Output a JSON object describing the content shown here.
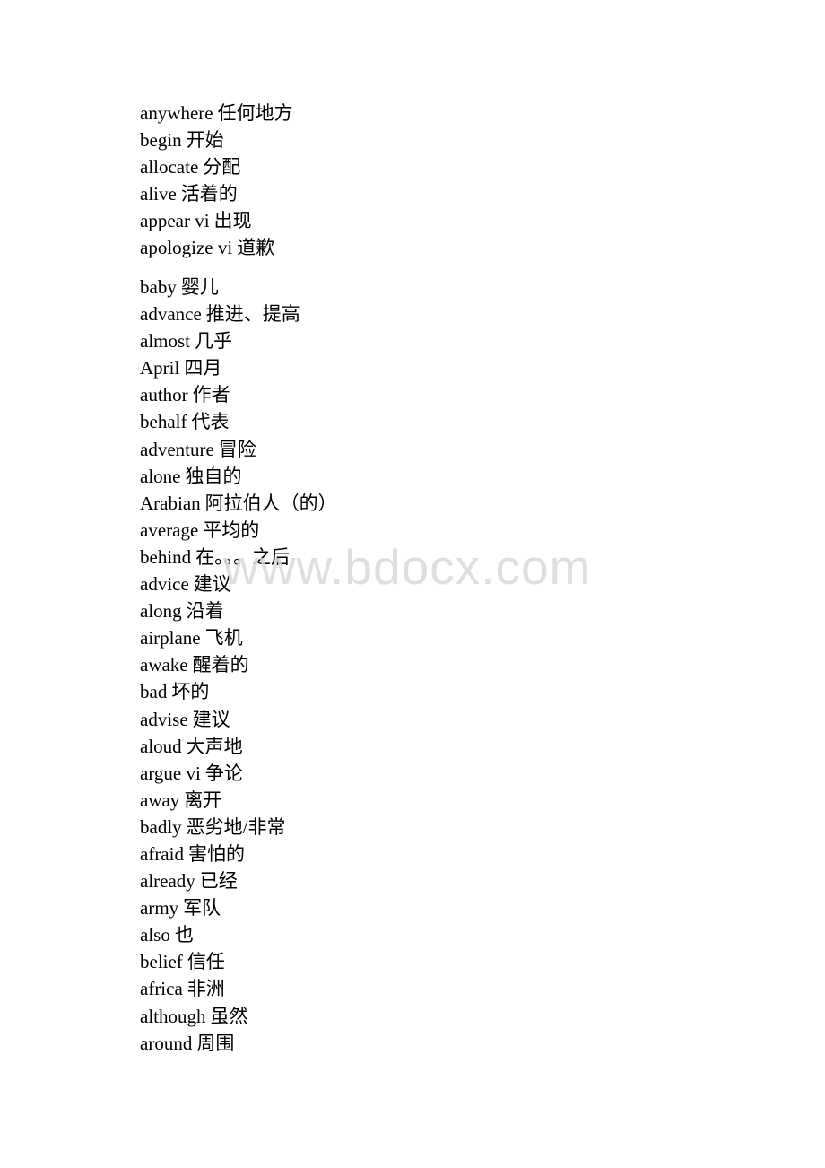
{
  "watermark": "www.bdocx.com",
  "groups": [
    {
      "entries": [
        {
          "word": "anywhere",
          "meaning": "任何地方"
        },
        {
          "word": "begin",
          "meaning": "开始"
        },
        {
          "word": "allocate",
          "meaning": "分配"
        },
        {
          "word": "alive",
          "meaning": "活着的"
        },
        {
          "word": "appear vi",
          "meaning": "出现"
        },
        {
          "word": "apologize vi",
          "meaning": "道歉"
        }
      ]
    },
    {
      "entries": [
        {
          "word": "baby",
          "meaning": "婴儿"
        },
        {
          "word": "advance",
          "meaning": "推进、提高"
        },
        {
          "word": "almost",
          "meaning": "几乎"
        },
        {
          "word": "April",
          "meaning": "四月"
        },
        {
          "word": "author",
          "meaning": "作者"
        },
        {
          "word": "behalf",
          "meaning": "代表"
        },
        {
          "word": "adventure",
          "meaning": "冒险"
        },
        {
          "word": "alone",
          "meaning": "独自的"
        },
        {
          "word": "Arabian",
          "meaning": "阿拉伯人（的）"
        },
        {
          "word": "average",
          "meaning": "平均的"
        },
        {
          "word": "behind",
          "meaning": "在。。。之后"
        },
        {
          "word": "advice",
          "meaning": "建议"
        },
        {
          "word": "along",
          "meaning": "沿着"
        },
        {
          "word": "airplane",
          "meaning": "飞机"
        },
        {
          "word": "awake",
          "meaning": "醒着的"
        },
        {
          "word": "bad",
          "meaning": "坏的"
        },
        {
          "word": "advise",
          "meaning": "建议"
        },
        {
          "word": "aloud",
          "meaning": "大声地"
        },
        {
          "word": "argue vi",
          "meaning": "争论"
        },
        {
          "word": "away",
          "meaning": "离开"
        },
        {
          "word": "badly",
          "meaning": "恶劣地/非常"
        },
        {
          "word": "afraid",
          "meaning": "害怕的"
        },
        {
          "word": "already",
          "meaning": "已经"
        },
        {
          "word": "army",
          "meaning": "军队"
        },
        {
          "word": "also",
          "meaning": "也"
        },
        {
          "word": "belief",
          "meaning": "信任"
        },
        {
          "word": "africa",
          "meaning": "非洲"
        },
        {
          "word": "although",
          "meaning": "虽然"
        },
        {
          "word": "around",
          "meaning": "周围"
        }
      ]
    }
  ]
}
